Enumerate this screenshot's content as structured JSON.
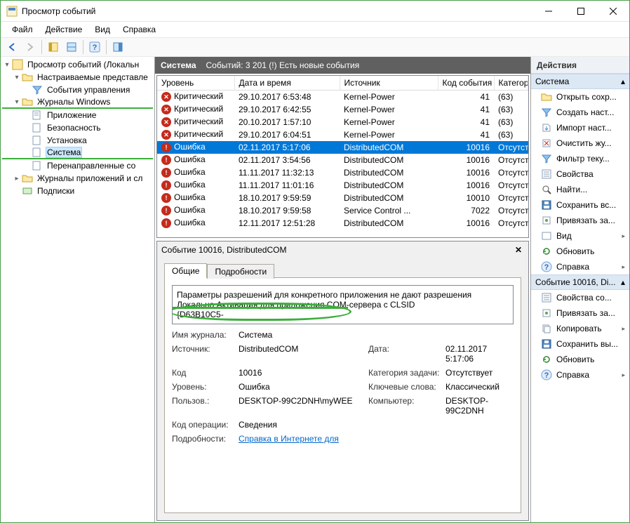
{
  "window_title": "Просмотр событий",
  "menu": [
    "Файл",
    "Действие",
    "Вид",
    "Справка"
  ],
  "tree": {
    "root": "Просмотр событий (Локальн",
    "custom": "Настраиваемые представле",
    "admin": "События управления",
    "winlogs": "Журналы Windows",
    "winlogs_items": [
      "Приложение",
      "Безопасность",
      "Установка",
      "Система",
      "Перенаправленные со"
    ],
    "apps": "Журналы приложений и сл",
    "subs": "Подписки"
  },
  "log_header": {
    "name": "Система",
    "count": "Событий: 3 201 (!) Есть новые события"
  },
  "columns": [
    "Уровень",
    "Дата и время",
    "Источник",
    "Код события",
    "Категория зад"
  ],
  "events": [
    {
      "level": "Критический",
      "icon": "critical",
      "date": "29.10.2017 6:53:48",
      "source": "Kernel-Power",
      "id": "41",
      "cat": "(63)"
    },
    {
      "level": "Критический",
      "icon": "critical",
      "date": "29.10.2017 6:42:55",
      "source": "Kernel-Power",
      "id": "41",
      "cat": "(63)"
    },
    {
      "level": "Критический",
      "icon": "critical",
      "date": "20.10.2017 1:57:10",
      "source": "Kernel-Power",
      "id": "41",
      "cat": "(63)"
    },
    {
      "level": "Критический",
      "icon": "critical",
      "date": "29.10.2017 6:04:51",
      "source": "Kernel-Power",
      "id": "41",
      "cat": "(63)"
    },
    {
      "level": "Ошибка",
      "icon": "error",
      "date": "02.11.2017 5:17:06",
      "source": "DistributedCOM",
      "id": "10016",
      "cat": "Отсутствует",
      "selected": true
    },
    {
      "level": "Ошибка",
      "icon": "error",
      "date": "02.11.2017 3:54:56",
      "source": "DistributedCOM",
      "id": "10016",
      "cat": "Отсутствует"
    },
    {
      "level": "Ошибка",
      "icon": "error",
      "date": "11.11.2017 11:32:13",
      "source": "DistributedCOM",
      "id": "10016",
      "cat": "Отсутствует"
    },
    {
      "level": "Ошибка",
      "icon": "error",
      "date": "11.11.2017 11:01:16",
      "source": "DistributedCOM",
      "id": "10016",
      "cat": "Отсутствует"
    },
    {
      "level": "Ошибка",
      "icon": "error",
      "date": "18.10.2017 9:59:59",
      "source": "DistributedCOM",
      "id": "10010",
      "cat": "Отсутствует"
    },
    {
      "level": "Ошибка",
      "icon": "error",
      "date": "18.10.2017 9:59:58",
      "source": "Service Control ...",
      "id": "7022",
      "cat": "Отсутствует"
    },
    {
      "level": "Ошибка",
      "icon": "error",
      "date": "12.11.2017 12:51:28",
      "source": "DistributedCOM",
      "id": "10016",
      "cat": "Отсутствует"
    }
  ],
  "details": {
    "title": "Событие 10016, DistributedCOM",
    "tabs": [
      "Общие",
      "Подробности"
    ],
    "description": "Параметры разрешений для конкретного приложения не дают разрешения Локально Активация для приложения COM-сервера с CLSID\n{D63B10C5-",
    "journal_lbl": "Имя журнала:",
    "journal_val": "Система",
    "source_lbl": "Источник:",
    "source_val": "DistributedCOM",
    "date_lbl": "Дата:",
    "date_val": "02.11.2017 5:17:06",
    "code_lbl": "Код",
    "code_val": "10016",
    "taskcat_lbl": "Категория задачи:",
    "taskcat_val": "Отсутствует",
    "level_lbl": "Уровень:",
    "level_val": "Ошибка",
    "keywords_lbl": "Ключевые слова:",
    "keywords_val": "Классический",
    "user_lbl": "Пользов.:",
    "user_val": "DESKTOP-99C2DNH\\myWEE",
    "computer_lbl": "Компьютер:",
    "computer_val": "DESKTOP-99C2DNH",
    "opcode_lbl": "Код операции:",
    "opcode_val": "Сведения",
    "more_lbl": "Подробности:",
    "more_link": "Справка в Интернете для"
  },
  "actions": {
    "title": "Действия",
    "group1": "Система",
    "items1": [
      "Открыть сохр...",
      "Создать наст...",
      "Импорт наст...",
      "Очистить жу...",
      "Фильтр теку...",
      "Свойства",
      "Найти...",
      "Сохранить вс...",
      "Привязать за...",
      "Вид",
      "Обновить",
      "Справка"
    ],
    "group2": "Событие 10016, Di...",
    "items2": [
      "Свойства со...",
      "Привязать за...",
      "Копировать",
      "Сохранить вы...",
      "Обновить",
      "Справка"
    ]
  }
}
